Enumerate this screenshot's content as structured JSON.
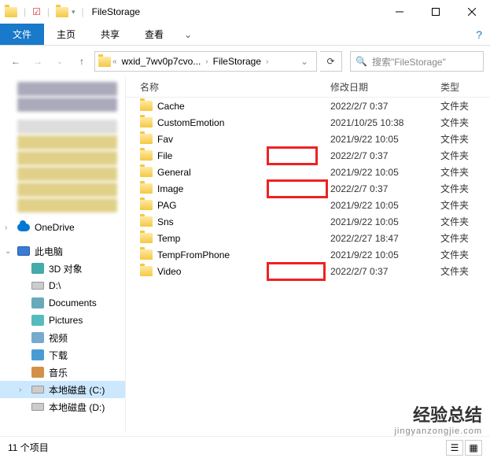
{
  "window": {
    "title": "FileStorage",
    "minimize": "—",
    "maximize": "☐",
    "close": "✕"
  },
  "ribbon": {
    "file": "文件",
    "home": "主页",
    "share": "共享",
    "view": "查看"
  },
  "address": {
    "crumb1": "wxid_7wv0p7cvo...",
    "crumb2": "FileStorage"
  },
  "search": {
    "placeholder": "搜索\"FileStorage\""
  },
  "columns": {
    "name": "名称",
    "date": "修改日期",
    "type": "类型"
  },
  "rows": [
    {
      "name": "Cache",
      "date": "2022/2/7 0:37",
      "type": "文件夹"
    },
    {
      "name": "CustomEmotion",
      "date": "2021/10/25 10:38",
      "type": "文件夹"
    },
    {
      "name": "Fav",
      "date": "2021/9/22 10:05",
      "type": "文件夹"
    },
    {
      "name": "File",
      "date": "2022/2/7 0:37",
      "type": "文件夹"
    },
    {
      "name": "General",
      "date": "2021/9/22 10:05",
      "type": "文件夹"
    },
    {
      "name": "Image",
      "date": "2022/2/7 0:37",
      "type": "文件夹"
    },
    {
      "name": "PAG",
      "date": "2021/9/22 10:05",
      "type": "文件夹"
    },
    {
      "name": "Sns",
      "date": "2021/9/22 10:05",
      "type": "文件夹"
    },
    {
      "name": "Temp",
      "date": "2022/2/27 18:47",
      "type": "文件夹"
    },
    {
      "name": "TempFromPhone",
      "date": "2021/9/22 10:05",
      "type": "文件夹"
    },
    {
      "name": "Video",
      "date": "2022/2/7 0:37",
      "type": "文件夹"
    }
  ],
  "sidebar": {
    "onedrive": "OneDrive",
    "thispc": "此电脑",
    "objects3d": "3D 对象",
    "d_drive": "D:\\",
    "documents": "Documents",
    "pictures": "Pictures",
    "videos": "视频",
    "downloads": "下载",
    "music": "音乐",
    "localc": "本地磁盘 (C:)",
    "locald": "本地磁盘 (D:)"
  },
  "status": {
    "count": "11 个项目"
  },
  "watermark": {
    "line1": "经验总结",
    "line2": "jingyanzongjie.com"
  }
}
